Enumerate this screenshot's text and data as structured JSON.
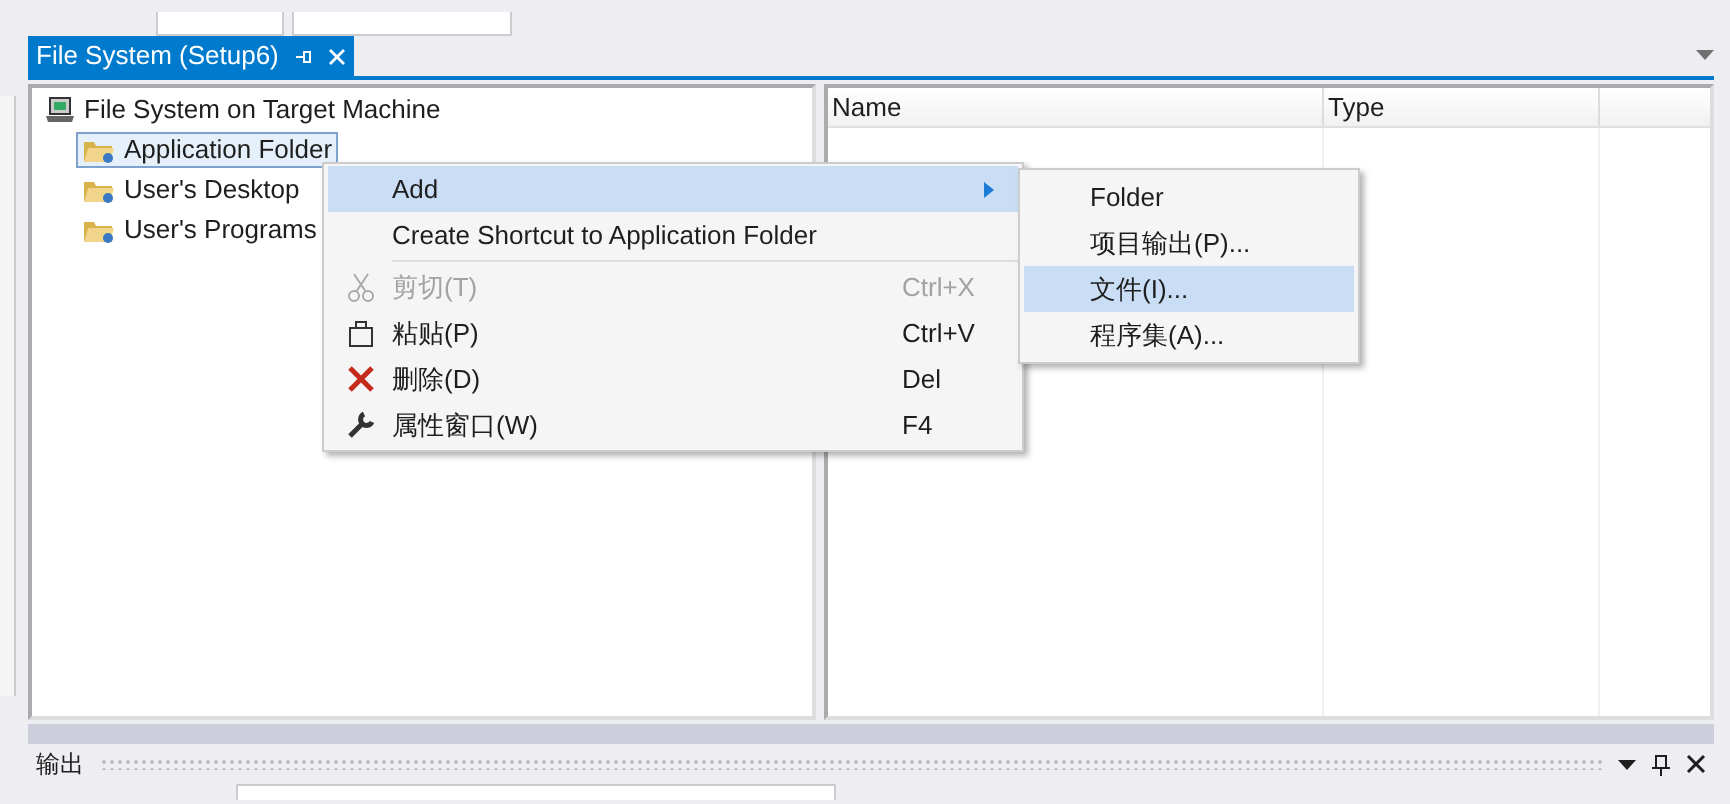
{
  "tab": {
    "title": "File System (Setup6)",
    "selected": true
  },
  "tree": {
    "root": {
      "label": "File System on Target Machine",
      "children": [
        {
          "label": "Application Folder",
          "selected": true
        },
        {
          "label": "User's Desktop",
          "selected": false
        },
        {
          "label": "User's Programs",
          "selected": false
        }
      ]
    }
  },
  "list": {
    "columns": [
      "Name",
      "Type"
    ]
  },
  "context_menu": {
    "items": [
      {
        "kind": "submenu",
        "label": "Add",
        "highlighted": true
      },
      {
        "kind": "item",
        "label": "Create Shortcut to Application Folder",
        "highlighted": false
      },
      {
        "kind": "separator"
      },
      {
        "kind": "cut",
        "label": "剪切(T)",
        "shortcut": "Ctrl+X",
        "disabled": true,
        "highlighted": false
      },
      {
        "kind": "paste",
        "label": "粘贴(P)",
        "shortcut": "Ctrl+V",
        "disabled": false,
        "highlighted": false
      },
      {
        "kind": "delete",
        "label": "删除(D)",
        "shortcut": "Del",
        "disabled": false,
        "highlighted": false
      },
      {
        "kind": "properties",
        "label": "属性窗口(W)",
        "shortcut": "F4",
        "disabled": false,
        "highlighted": false
      }
    ]
  },
  "submenu": {
    "items": [
      {
        "label": "Folder",
        "highlighted": false
      },
      {
        "label": "项目输出(P)...",
        "highlighted": false
      },
      {
        "label": "文件(I)...",
        "highlighted": true
      },
      {
        "label": "程序集(A)...",
        "highlighted": false
      }
    ]
  },
  "output_panel": {
    "title": "输出"
  }
}
